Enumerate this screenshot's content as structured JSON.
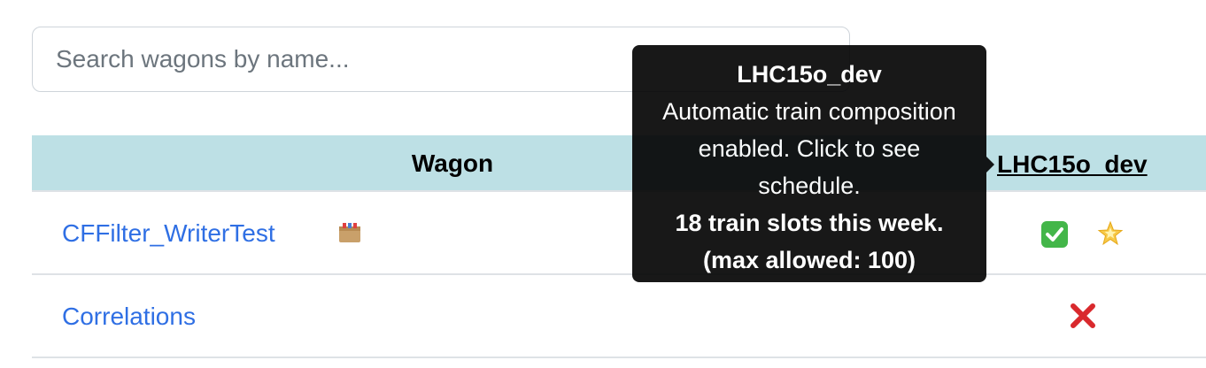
{
  "search": {
    "placeholder": "Search wagons by name..."
  },
  "table": {
    "header": {
      "wagon": "Wagon",
      "train": "LHC15o_dev"
    },
    "rows": [
      {
        "name": "CFFilter_WriterTest",
        "icon": "package-icon",
        "status": [
          "check-icon",
          "star-icon"
        ]
      },
      {
        "name": "Correlations",
        "status": [
          "cross-icon"
        ]
      }
    ]
  },
  "tooltip": {
    "title": "LHC15o_dev",
    "line1": "Automatic train composition",
    "line2": "enabled. Click to see",
    "line3": "schedule.",
    "slots": "18 train slots this week.",
    "max": "(max allowed: 100)"
  },
  "colors": {
    "header_bg": "#bde0e5",
    "link": "#2f6fe4",
    "check": "#43b649",
    "cross": "#d9292d"
  }
}
